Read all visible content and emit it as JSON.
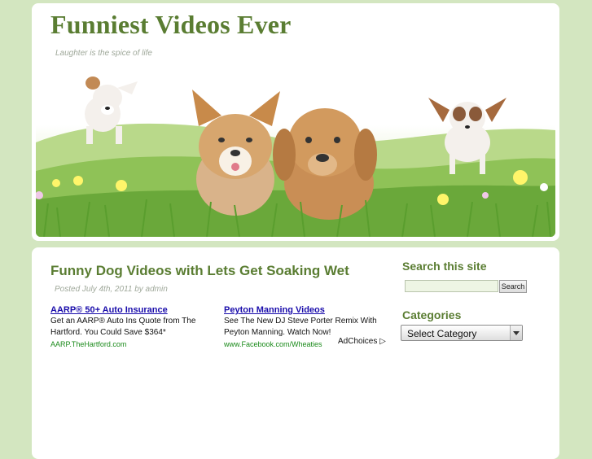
{
  "site": {
    "title": "Funniest Videos Ever",
    "tagline": "Laughter is the spice of life"
  },
  "post": {
    "title": "Funny Dog Videos with Lets Get Soaking Wet",
    "meta": "Posted July 4th, 2011 by admin"
  },
  "ads": [
    {
      "title": "AARP® 50+ Auto Insurance",
      "body": "Get an AARP® Auto Ins Quote from The Hartford. You Could Save $364*",
      "url": "AARP.TheHartford.com"
    },
    {
      "title": "Peyton Manning Videos",
      "body": "See The New DJ Steve Porter Remix With Peyton Manning. Watch Now!",
      "url": "www.Facebook.com/Wheaties"
    }
  ],
  "adchoices": "AdChoices ▷",
  "sidebar": {
    "search_title": "Search this site",
    "search_button": "Search",
    "categories_title": "Categories",
    "categories_selected": "Select Category"
  },
  "colors": {
    "background": "#d3e6c0",
    "title_green": "#5a7d32",
    "link_blue": "#1a0dab",
    "ad_url_green": "#1a8a1a"
  }
}
